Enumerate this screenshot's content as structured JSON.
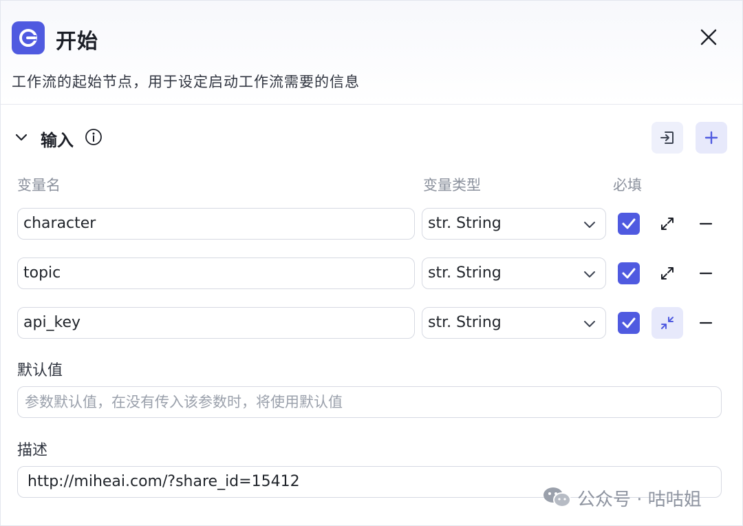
{
  "header": {
    "icon": "start-node-icon",
    "title": "开始",
    "description": "工作流的起始节点，用于设定启动工作流需要的信息"
  },
  "section": {
    "title": "输入",
    "info_icon": "info-icon",
    "columns": {
      "name": "变量名",
      "type": "变量类型",
      "required": "必填"
    },
    "rows": [
      {
        "name": "character",
        "type": "str. String",
        "required": true,
        "expand_icon": "expand-icon"
      },
      {
        "name": "topic",
        "type": "str. String",
        "required": true,
        "expand_icon": "expand-icon"
      },
      {
        "name": "api_key",
        "type": "str. String",
        "required": true,
        "expand_icon": "collapse-icon"
      }
    ]
  },
  "detail": {
    "default_label": "默认值",
    "default_placeholder": "参数默认值，在没有传入该参数时，将使用默认值",
    "desc_label": "描述",
    "desc_value": "http://miheai.com/?share_id=15412"
  },
  "watermark": {
    "text": "公众号 · 咕咕姐"
  },
  "colors": {
    "accent": "#4f5ae0",
    "border": "#d6d9e2",
    "muted": "#8a909c"
  }
}
